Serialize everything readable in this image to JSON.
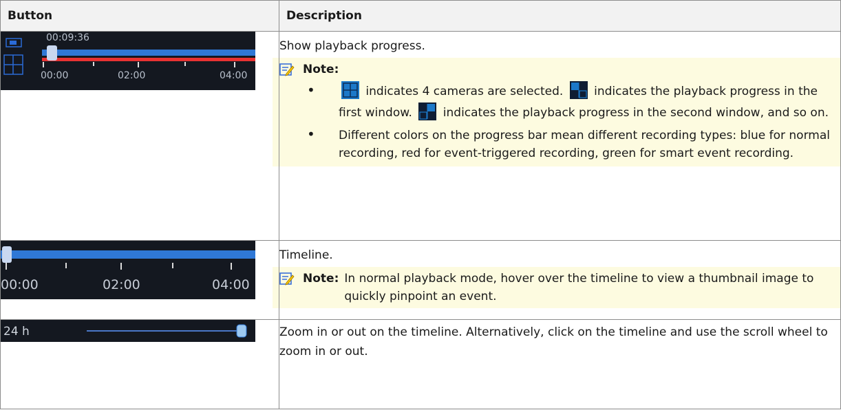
{
  "headers": {
    "button": "Button",
    "description": "Description"
  },
  "rows": [
    {
      "preview": {
        "time": "00:09:36",
        "ticks": [
          "00:00",
          "02:00",
          "04:00"
        ]
      },
      "text": "Show playback progress.",
      "note_label": "Note:",
      "bullet1": {
        "a": "indicates 4 cameras are selected.",
        "b": "indicates the playback progress in the first window.",
        "c": "indicates the playback progress in the second window, and so on."
      },
      "bullet2": "Different colors on the progress bar mean different recording types: blue for normal recording, red for event-triggered recording, green for smart event recording."
    },
    {
      "preview": {
        "ticks": [
          "00:00",
          "02:00",
          "04:00"
        ]
      },
      "text": "Timeline.",
      "note_label": "Note:",
      "note_text": "In normal playback mode, hover over the timeline to view a thumbnail image to quickly pinpoint an event."
    },
    {
      "preview": {
        "label": "24 h"
      },
      "text": "Zoom in or out on the timeline. Alternatively, click on the timeline and use the scroll wheel to zoom in or out."
    }
  ]
}
